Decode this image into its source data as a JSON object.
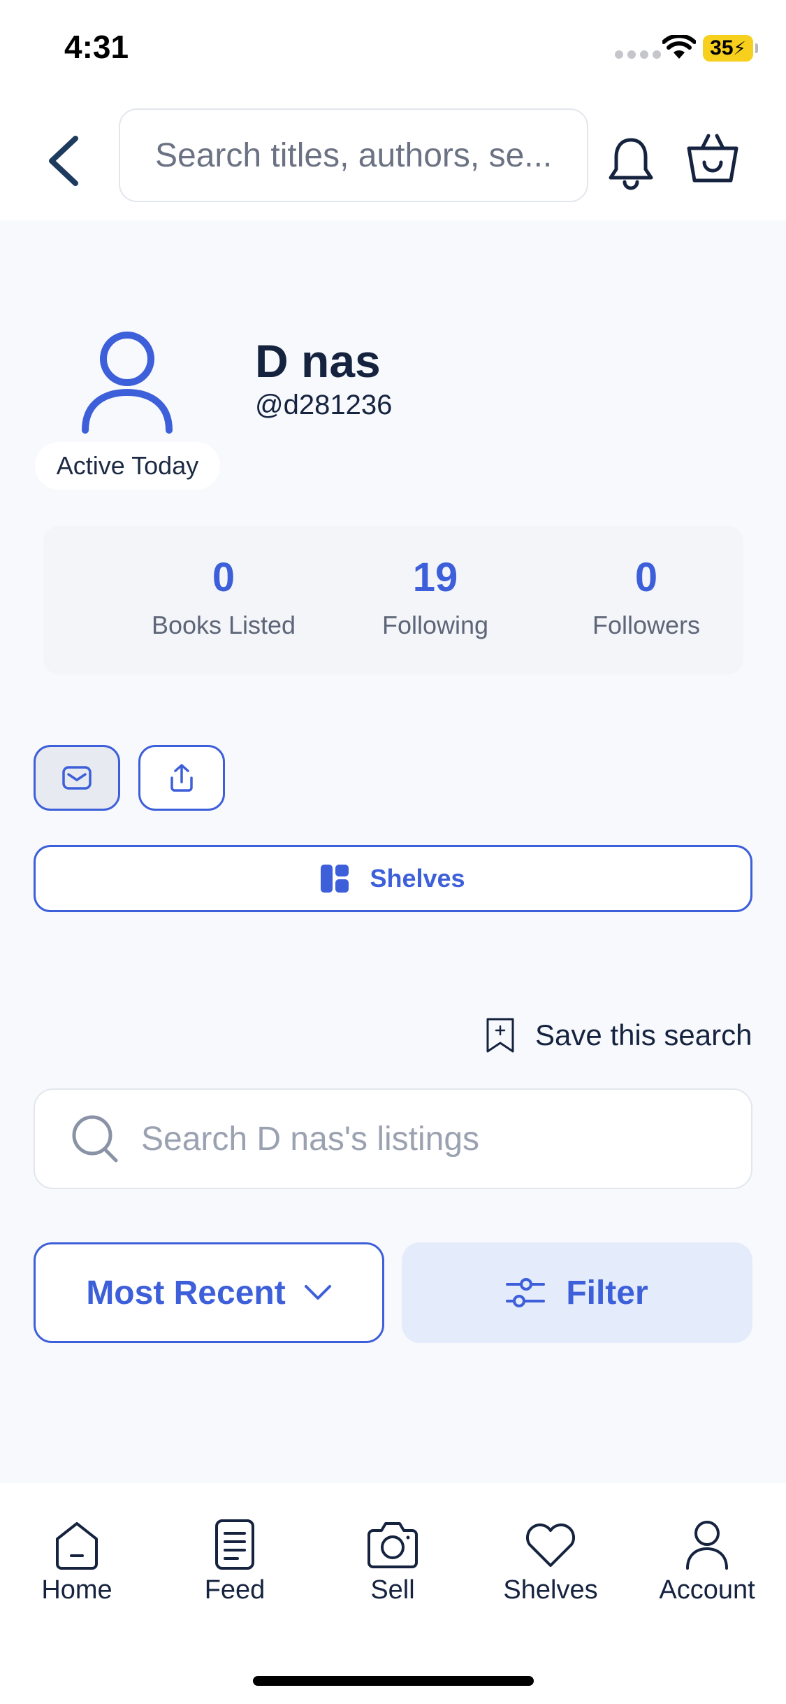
{
  "status_bar": {
    "time": "4:31",
    "battery": "35"
  },
  "header": {
    "search_placeholder": "Search titles, authors, se...",
    "icons": [
      "back-chevron-icon",
      "bell-icon",
      "basket-icon"
    ]
  },
  "profile": {
    "name": "D nas",
    "handle": "@d281236",
    "activity": "Active Today"
  },
  "stats": [
    {
      "value": "0",
      "label": "Books Listed"
    },
    {
      "value": "19",
      "label": "Following"
    },
    {
      "value": "0",
      "label": "Followers"
    }
  ],
  "actions": {
    "shelves_label": "Shelves",
    "save_search_label": "Save this search",
    "listing_search_placeholder": "Search D nas's listings",
    "sort_label": "Most Recent",
    "filter_label": "Filter"
  },
  "tabbar": [
    {
      "label": "Home",
      "icon": "home-icon"
    },
    {
      "label": "Feed",
      "icon": "feed-icon"
    },
    {
      "label": "Sell",
      "icon": "camera-icon"
    },
    {
      "label": "Shelves",
      "icon": "heart-icon"
    },
    {
      "label": "Account",
      "icon": "account-icon"
    }
  ],
  "colors": {
    "accent": "#3d5fd9",
    "text_dark": "#15233f",
    "background": "#f7f9fc",
    "filter_bg": "#e4ecfb"
  }
}
